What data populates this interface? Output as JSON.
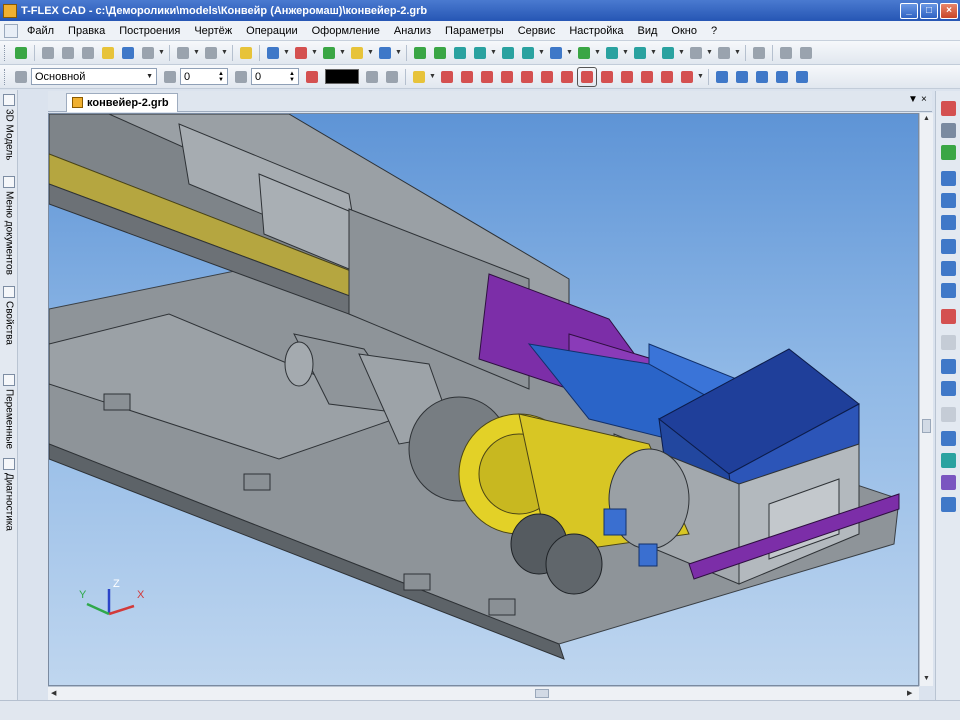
{
  "window": {
    "title": "T-FLEX CAD - c:\\Деморолики\\models\\Конвейр (Анжеромаш)\\конвейер-2.grb",
    "controls": {
      "minimize": "_",
      "maximize": "□",
      "close": "×"
    }
  },
  "menu": {
    "items": [
      "Файл",
      "Правка",
      "Построения",
      "Чертёж",
      "Операции",
      "Оформление",
      "Анализ",
      "Параметры",
      "Сервис",
      "Настройка",
      "Вид",
      "Окно",
      "?"
    ]
  },
  "toolbar2": {
    "layer_value": "Основной",
    "level_value": "0",
    "priority_value": "0"
  },
  "side_tabs": [
    "3D Модель",
    "Меню документов",
    "Свойства",
    "Переменные",
    "Диагностика"
  ],
  "document": {
    "tab_label": "конвейер-2.grb"
  },
  "triad": {
    "x_label": "X",
    "y_label": "Y",
    "z_label": "Z"
  },
  "colors": {
    "viewport_top": "#5e94d6",
    "model_gray": "#8e9499",
    "gear_yellow": "#e3d127",
    "cover_blue": "#1f3f9a",
    "accent_purple": "#7c2ea8",
    "rail_olive": "#b5a640"
  }
}
